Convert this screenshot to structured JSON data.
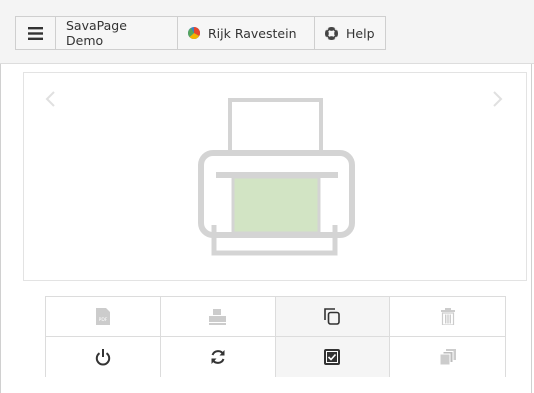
{
  "header": {
    "menu_icon": "hamburger-menu-icon",
    "app_label": "SavaPage Demo",
    "user_label": "Rijk Ravestein",
    "user_icon": "user-pie-icon",
    "help_label": "Help",
    "help_icon": "lifebuoy-icon"
  },
  "preview": {
    "left_arrow_icon": "chevron-left-icon",
    "right_arrow_icon": "chevron-right-icon",
    "illustration": "printer-icon"
  },
  "actions": {
    "row1": [
      "pdf-icon",
      "print-icon",
      "copy-icon",
      "trash-icon"
    ],
    "row2": [
      "power-icon",
      "refresh-icon",
      "checkbox-icon",
      "copies-icon"
    ]
  },
  "colors": {
    "accent_green": "#d2e4c4",
    "icon_gray": "#cccccc",
    "icon_dark": "#333333"
  }
}
